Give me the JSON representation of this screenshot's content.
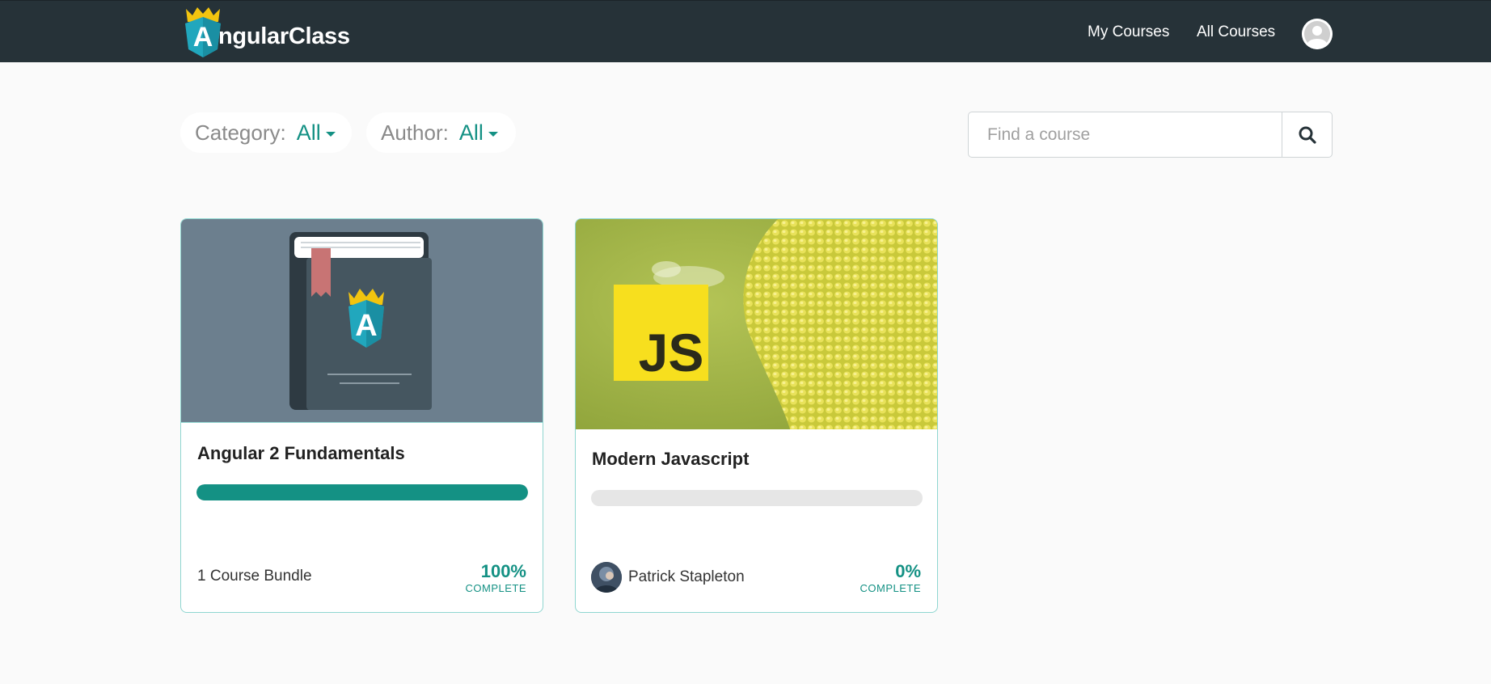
{
  "header": {
    "logo_letter": "A",
    "logo_text": "ngularClass",
    "nav": {
      "my_courses": "My Courses",
      "all_courses": "All Courses"
    }
  },
  "filters": {
    "category": {
      "label": "Category:",
      "value": "All"
    },
    "author": {
      "label": "Author:",
      "value": "All"
    }
  },
  "search": {
    "placeholder": "Find a course",
    "value": ""
  },
  "courses": [
    {
      "title": "Angular 2 Fundamentals",
      "meta": "1 Course Bundle",
      "progress_percent": 100,
      "progress_text": "100%",
      "complete_label": "COMPLETE"
    },
    {
      "title": "Modern Javascript",
      "author": "Patrick Stapleton",
      "image_badge": "JS",
      "progress_percent": 0,
      "progress_text": "0%",
      "complete_label": "COMPLETE"
    }
  ],
  "colors": {
    "header_bg": "#263238",
    "accent": "#149184",
    "card_border": "#8fd6d0",
    "page_bg": "#fafafa"
  }
}
